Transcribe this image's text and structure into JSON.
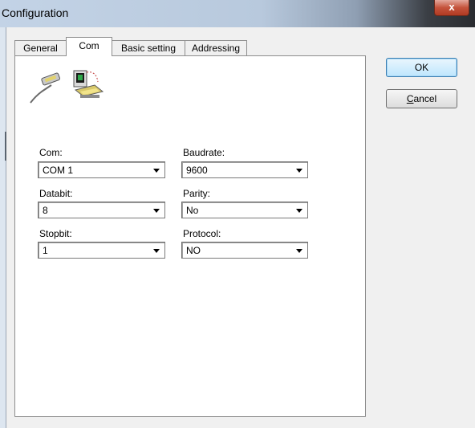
{
  "window": {
    "title": "Configuration",
    "close_glyph": "x"
  },
  "tabs": [
    {
      "label": "General",
      "active": false
    },
    {
      "label": "Com",
      "active": true
    },
    {
      "label": "Basic setting",
      "active": false
    },
    {
      "label": "Addressing",
      "active": false
    }
  ],
  "fields": {
    "com": {
      "label": "Com:",
      "value": "COM 1"
    },
    "baudrate": {
      "label": "Baudrate:",
      "value": "9600"
    },
    "databit": {
      "label": "Databit:",
      "value": "8"
    },
    "parity": {
      "label": "Parity:",
      "value": "No"
    },
    "stopbit": {
      "label": "Stopbit:",
      "value": "1"
    },
    "protocol": {
      "label": "Protocol:",
      "value": "NO"
    }
  },
  "buttons": {
    "ok": "OK",
    "cancel_mnemonic": "C",
    "cancel_rest": "ancel"
  },
  "icons": {
    "header": "serial-cable-computer-icon"
  },
  "colors": {
    "dialog_bg": "#f0f0f0",
    "panel_bg": "#ffffff",
    "close_red": "#c5533c"
  }
}
